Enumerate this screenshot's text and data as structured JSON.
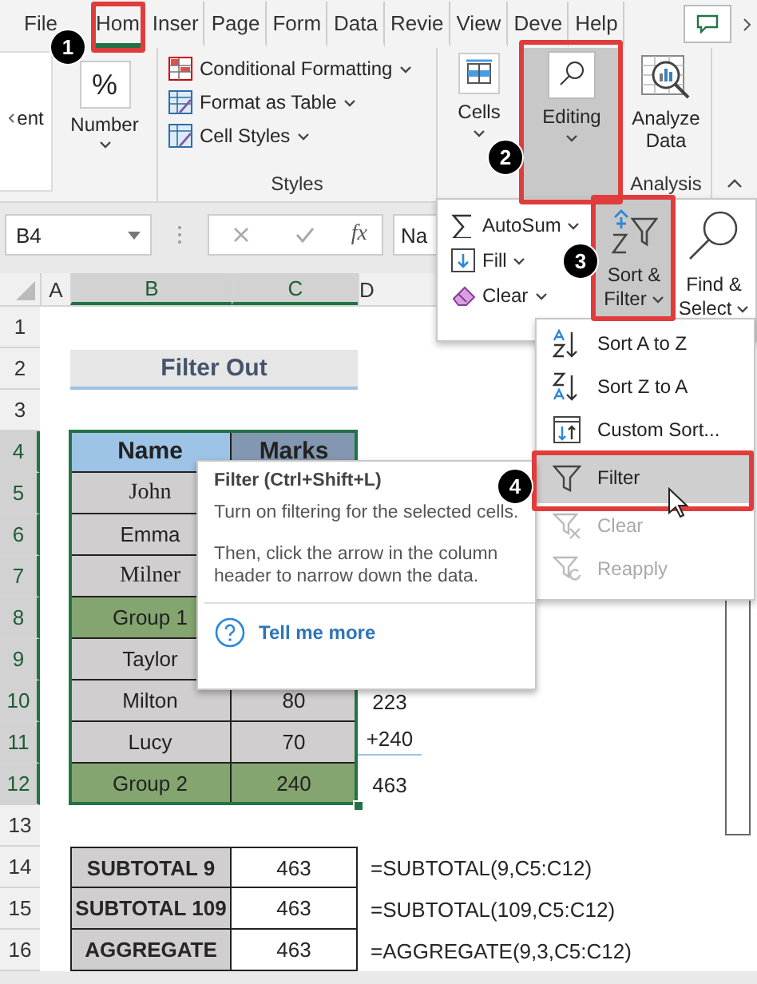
{
  "ribbon_tabs": [
    {
      "label": "File",
      "selected": false
    },
    {
      "label": "Hom",
      "selected": true
    },
    {
      "label": "Inser",
      "selected": false
    },
    {
      "label": "Page",
      "selected": false
    },
    {
      "label": "Form",
      "selected": false
    },
    {
      "label": "Data",
      "selected": false
    },
    {
      "label": "Revie",
      "selected": false
    },
    {
      "label": "View",
      "selected": false
    },
    {
      "label": "Deve",
      "selected": false
    },
    {
      "label": "Help",
      "selected": false
    }
  ],
  "ribbon": {
    "cut_group": "ent",
    "number": "Number",
    "number_icon": "%",
    "styles": {
      "items": [
        {
          "label": "Conditional Formatting",
          "kind": "conditional"
        },
        {
          "label": "Format as Table",
          "kind": "table"
        },
        {
          "label": "Cell Styles",
          "kind": "styles"
        }
      ],
      "group_label": "Styles"
    },
    "cells": "Cells",
    "editing": {
      "label": "Editing",
      "pressed": true
    },
    "analysis": {
      "button": "Analyze Data",
      "group_label": "Analysis"
    }
  },
  "formula_bar": {
    "name_box": "B4",
    "function_label": "fx",
    "value": "Na"
  },
  "columns": [
    {
      "label": "A",
      "selected": false
    },
    {
      "label": "B",
      "selected": true
    },
    {
      "label": "C",
      "selected": true
    },
    {
      "label": "D",
      "selected": false
    }
  ],
  "rows": [
    {
      "label": "1",
      "selected": false
    },
    {
      "label": "2",
      "selected": false
    },
    {
      "label": "3",
      "selected": false
    },
    {
      "label": "4",
      "selected": true
    },
    {
      "label": "5",
      "selected": true
    },
    {
      "label": "6",
      "selected": true
    },
    {
      "label": "7",
      "selected": true
    },
    {
      "label": "8",
      "selected": true
    },
    {
      "label": "9",
      "selected": true
    },
    {
      "label": "10",
      "selected": true
    },
    {
      "label": "11",
      "selected": true
    },
    {
      "label": "12",
      "selected": true
    },
    {
      "label": "13",
      "selected": false
    },
    {
      "label": "14",
      "selected": false
    },
    {
      "label": "15",
      "selected": false
    },
    {
      "label": "16",
      "selected": false
    }
  ],
  "sheet": {
    "title": "Filter Out",
    "table": {
      "columns": [
        "Name",
        "Marks"
      ],
      "rows": [
        {
          "name": "John",
          "kind": "item",
          "serif": true
        },
        {
          "name": "Emma",
          "kind": "item",
          "serif": false
        },
        {
          "name": "Milner",
          "kind": "item",
          "serif": true
        },
        {
          "name": "Group 1",
          "kind": "group",
          "serif": false
        },
        {
          "name": "Taylor",
          "kind": "item",
          "serif": false
        },
        {
          "name": "Milton",
          "marks": "80",
          "kind": "item",
          "serif": false
        },
        {
          "name": "Lucy",
          "marks": "70",
          "kind": "item",
          "serif": false
        },
        {
          "name": "Group 2",
          "marks": "240",
          "kind": "group",
          "serif": false
        }
      ]
    },
    "calculation": [
      "223",
      "+240",
      "463"
    ],
    "summary": [
      {
        "label": "SUBTOTAL 9",
        "value": "463",
        "formula": "=SUBTOTAL(9,C5:C12)"
      },
      {
        "label": "SUBTOTAL 109",
        "value": "463",
        "formula": "=SUBTOTAL(109,C5:C12)"
      },
      {
        "label": "AGGREGATE",
        "value": "463",
        "formula": "=AGGREGATE(9,3,C5:C12)"
      }
    ]
  },
  "editing_menu": {
    "items": [
      {
        "label": "AutoSum",
        "kind": "autosum"
      },
      {
        "label": "Fill",
        "kind": "fill"
      },
      {
        "label": "Clear",
        "kind": "clear"
      }
    ],
    "big_buttons": [
      {
        "label": "Sort & Filter",
        "kind": "sort",
        "selected": true
      },
      {
        "label": "Find & Select",
        "kind": "find",
        "selected": false
      }
    ]
  },
  "sort_filter_menu": [
    {
      "label": "Sort A to Z",
      "kind": "sort-az",
      "selected": false,
      "disabled": false
    },
    {
      "label": "Sort Z to A",
      "kind": "sort-za",
      "selected": false,
      "disabled": false
    },
    {
      "label": "Custom Sort...",
      "kind": "custom",
      "selected": false,
      "disabled": false
    },
    {
      "label": "Filter",
      "kind": "filter",
      "selected": true,
      "disabled": false
    },
    {
      "label": "Clear",
      "kind": "clear",
      "selected": false,
      "disabled": true
    },
    {
      "label": "Reapply",
      "kind": "reapply",
      "selected": false,
      "disabled": true
    }
  ],
  "tooltip": {
    "title": "Filter (Ctrl+Shift+L)",
    "paragraphs": [
      "Turn on filtering for the selected cells.",
      "Then, click the arrow in the column header to narrow down the data."
    ],
    "link": "Tell me more"
  },
  "steps": [
    "1",
    "2",
    "3",
    "4"
  ]
}
